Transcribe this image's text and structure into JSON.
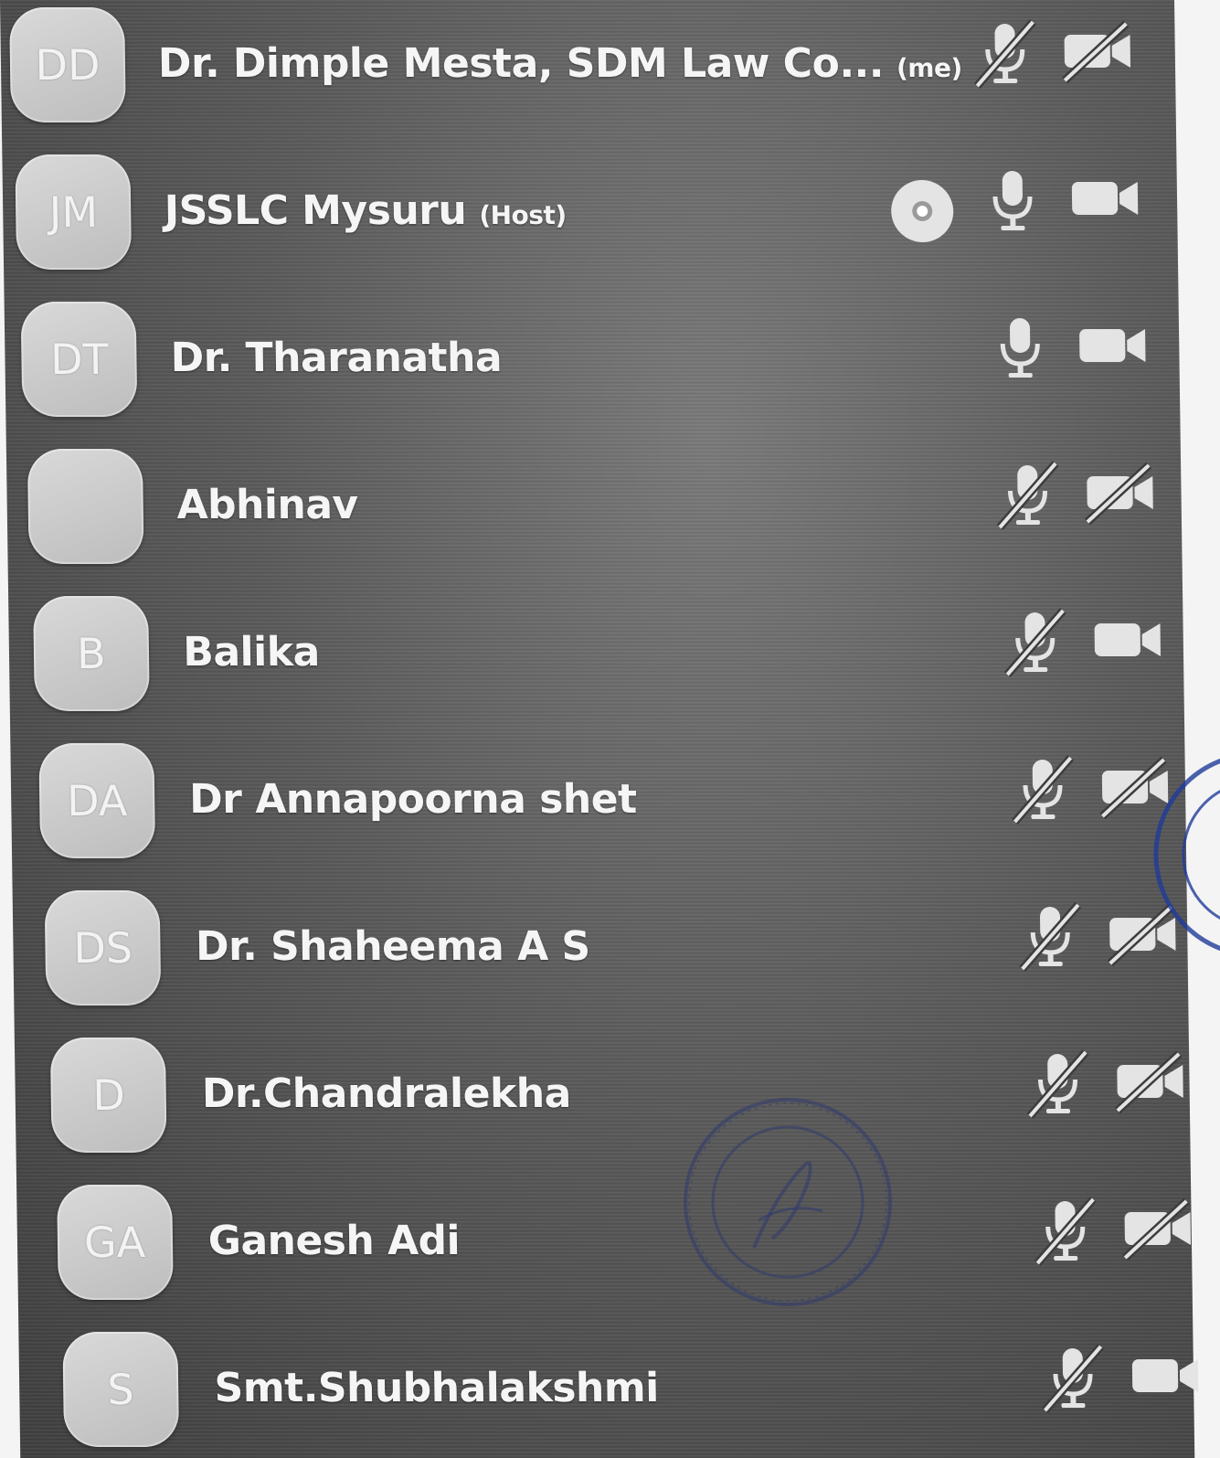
{
  "participants": [
    {
      "initials": "DD",
      "name": "Dr. Dimple Mesta, SDM Law Co...",
      "suffix": "(me)",
      "mic": "muted",
      "video": "off",
      "recording": false
    },
    {
      "initials": "JM",
      "name": "JSSLC Mysuru",
      "suffix": "(Host)",
      "mic": "on",
      "video": "on",
      "recording": true
    },
    {
      "initials": "DT",
      "name": "Dr. Tharanatha",
      "suffix": "",
      "mic": "on",
      "video": "on",
      "recording": false
    },
    {
      "initials": "",
      "name": "Abhinav",
      "suffix": "",
      "mic": "muted",
      "video": "off",
      "recording": false
    },
    {
      "initials": "B",
      "name": "Balika",
      "suffix": "",
      "mic": "muted",
      "video": "on",
      "recording": false
    },
    {
      "initials": "DA",
      "name": "Dr Annapoorna shet",
      "suffix": "",
      "mic": "muted",
      "video": "off",
      "recording": false
    },
    {
      "initials": "DS",
      "name": "Dr. Shaheema A S",
      "suffix": "",
      "mic": "muted",
      "video": "off",
      "recording": false
    },
    {
      "initials": "D",
      "name": "Dr.Chandralekha",
      "suffix": "",
      "mic": "muted",
      "video": "off",
      "recording": false
    },
    {
      "initials": "GA",
      "name": "Ganesh Adi",
      "suffix": "",
      "mic": "muted",
      "video": "off",
      "recording": false
    },
    {
      "initials": "S",
      "name": "Smt.Shubhalakshmi",
      "suffix": "",
      "mic": "muted",
      "video": "on",
      "recording": false
    }
  ],
  "icons": {
    "mic": "microphone-icon",
    "mic_muted": "microphone-muted-icon",
    "video": "video-camera-icon",
    "video_off": "video-camera-off-icon",
    "recording": "recording-icon",
    "stamp": "institution-seal-stamp"
  },
  "colors": {
    "text": "#f5f5f5",
    "avatar": "#cfcfcf",
    "icon": "#e4e4e4",
    "panel": "#595959",
    "stamp": "#3b3f8c"
  }
}
